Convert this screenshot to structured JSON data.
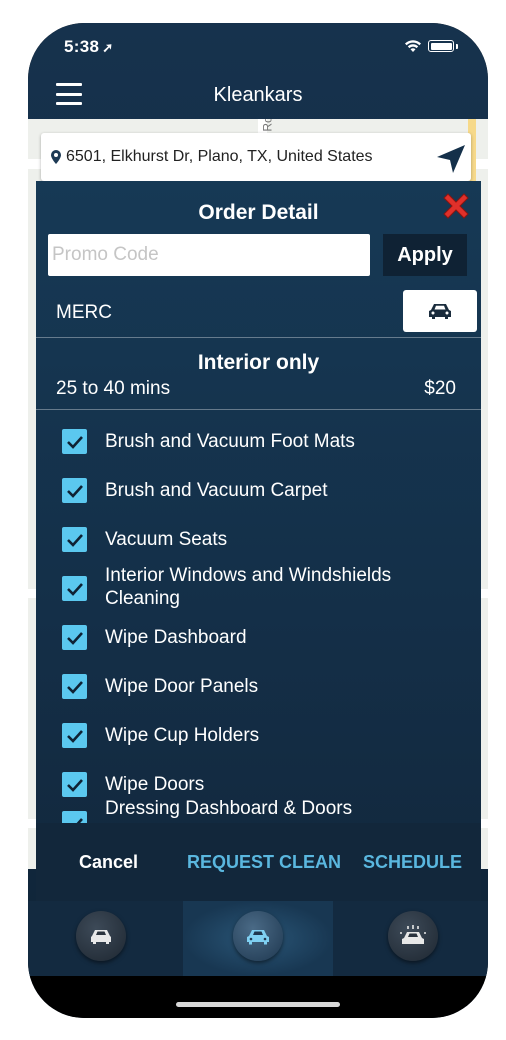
{
  "status_bar": {
    "time": "5:38",
    "location_icon": "location-arrow-icon",
    "wifi_icon": "wifi-icon",
    "battery_icon": "battery-icon"
  },
  "nav": {
    "title": "Kleankars",
    "menu_icon": "hamburger-menu-icon"
  },
  "map": {
    "address": "6501, Elkhurst Dr, Plano, TX, United States",
    "pin_icon": "map-pin-icon",
    "navigate_icon": "navigation-arrow-icon"
  },
  "order": {
    "title": "Order Detail",
    "close_icon": "close-x-icon",
    "promo": {
      "placeholder": "Promo Code",
      "value": "",
      "apply_label": "Apply"
    },
    "car_model": "MERC",
    "car_icon": "car-icon",
    "service_name": "Interior only",
    "duration": "25 to 40 mins",
    "price": "$20",
    "items": [
      {
        "label": "Brush and Vacuum Foot Mats",
        "checked": true
      },
      {
        "label": "Brush and Vacuum Carpet",
        "checked": true
      },
      {
        "label": "Vacuum Seats",
        "checked": true
      },
      {
        "label": "Interior Windows and Windshields Cleaning",
        "checked": true
      },
      {
        "label": "Wipe Dashboard",
        "checked": true
      },
      {
        "label": "Wipe Door Panels",
        "checked": true
      },
      {
        "label": "Wipe Cup Holders",
        "checked": true
      },
      {
        "label": "Wipe Doors",
        "checked": true
      },
      {
        "label": "Dressing Dashboard & Doors",
        "checked": true
      }
    ],
    "actions": {
      "cancel": "Cancel",
      "request": "REQUEST CLEAN",
      "schedule": "SCHEDULE"
    }
  },
  "tabs": [
    {
      "icon": "car-icon",
      "active": false
    },
    {
      "icon": "car-wash-icon",
      "active": true
    },
    {
      "icon": "car-wash-spray-icon",
      "active": false
    }
  ],
  "colors": {
    "accent": "#5ab7df",
    "checkbox": "#5bc8ef",
    "close": "#e0302a"
  }
}
